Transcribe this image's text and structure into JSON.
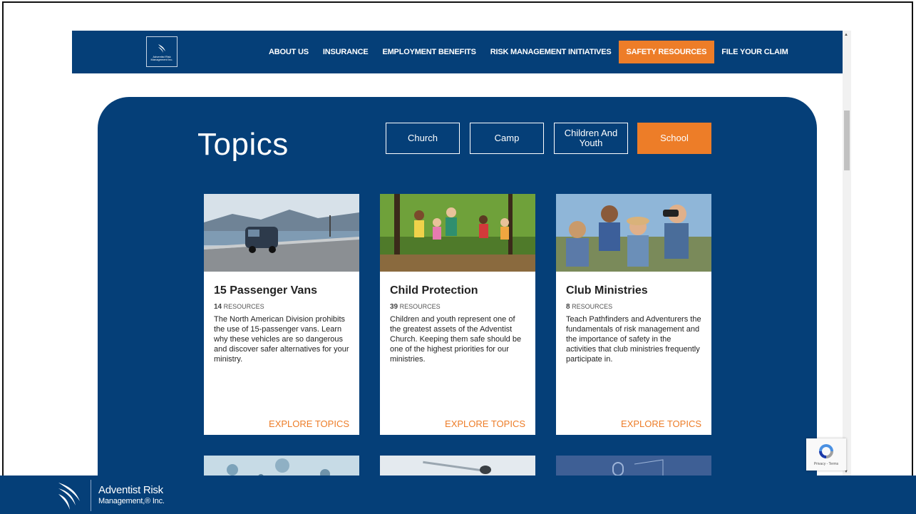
{
  "nav": {
    "logo_text": "Adventist Risk Management Inc.",
    "items": [
      {
        "label": "ABOUT US",
        "active": false
      },
      {
        "label": "INSURANCE",
        "active": false
      },
      {
        "label": "EMPLOYMENT BENEFITS",
        "active": false
      },
      {
        "label": "RISK MANAGEMENT INITIATIVES",
        "active": false
      },
      {
        "label": "SAFETY RESOURCES",
        "active": true
      },
      {
        "label": "FILE YOUR CLAIM",
        "active": false
      }
    ]
  },
  "topics": {
    "title": "Topics",
    "filters": [
      {
        "label": "Church",
        "active": false
      },
      {
        "label": "Camp",
        "active": false
      },
      {
        "label": "Children And Youth",
        "active": false
      },
      {
        "label": "School",
        "active": true
      }
    ]
  },
  "cards": [
    {
      "title": "15 Passenger Vans",
      "count": "14",
      "count_label": "RESOURCES",
      "description": "The North American Division prohibits the use of 15-passenger vans. Learn why these vehicles are so dangerous and discover safer alternatives for your ministry.",
      "cta": "EXPLORE TOPICS",
      "image": "van-on-coastal-road"
    },
    {
      "title": "Child Protection",
      "count": "39",
      "count_label": "RESOURCES",
      "description": "Children and youth represent one of the greatest assets of the Adventist Church. Keeping them safe should be one of the highest priorities for our ministries.",
      "cta": "EXPLORE TOPICS",
      "image": "children-running-in-forest"
    },
    {
      "title": "Club Ministries",
      "count": "8",
      "count_label": "RESOURCES",
      "description": "Teach Pathfinders and Adventurers the fundamentals of risk management and the importance of safety in the activities that club ministries frequently participate in.",
      "cta": "EXPLORE TOPICS",
      "image": "kids-with-binoculars"
    }
  ],
  "recaptcha": {
    "text": "Privacy - Terms"
  },
  "footer": {
    "name_line1": "Adventist Risk",
    "name_line2": "Management,® Inc."
  },
  "colors": {
    "navy": "#053f78",
    "orange": "#ed7d28"
  }
}
